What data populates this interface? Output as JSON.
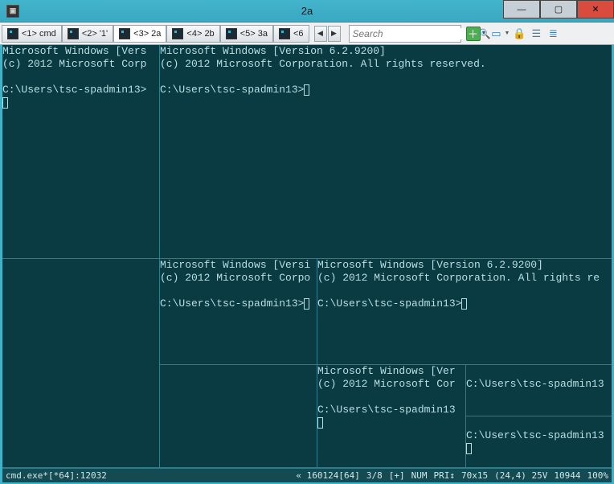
{
  "window": {
    "title": "2a"
  },
  "tabs": [
    {
      "label": "<1> cmd",
      "active": false
    },
    {
      "label": "<2> '1'",
      "active": false
    },
    {
      "label": "<3> 2a",
      "active": true
    },
    {
      "label": "<4> 2b",
      "active": false
    },
    {
      "label": "<5> 3a",
      "active": false
    },
    {
      "label": "<6",
      "active": false
    }
  ],
  "search": {
    "placeholder": "Search"
  },
  "terminal": {
    "version_line_full": "Microsoft Windows [Version 6.2.9200]",
    "version_line_trunc1": "Microsoft Windows [Vers",
    "version_line_trunc2": "Microsoft Windows [Versi",
    "version_line_trunc3": "Microsoft Windows [Ver",
    "copy_full": "(c) 2012 Microsoft Corporation. All rights reserved.",
    "copy_trunc1": "(c) 2012 Microsoft Corp",
    "copy_trunc2": "(c) 2012 Microsoft Corpo",
    "copy_trunc3": "(c) 2012 Microsoft Cor",
    "copy_trunc4": "(c) 2012 Microsoft Corporation. All rights re",
    "prompt": "C:\\Users\\tsc-spadmin13>",
    "prompt_trunc": "C:\\Users\\tsc-spadmin13"
  },
  "status": {
    "left": "cmd.exe*[*64]:12032",
    "buffer": "« 160124[64]",
    "panes": "3/8",
    "plus": "[+]",
    "num": "NUM",
    "pri": "PRI↕",
    "size": "70x15",
    "cursor": "(24,4) 25V",
    "chars": "10944",
    "zoom": "100%"
  }
}
